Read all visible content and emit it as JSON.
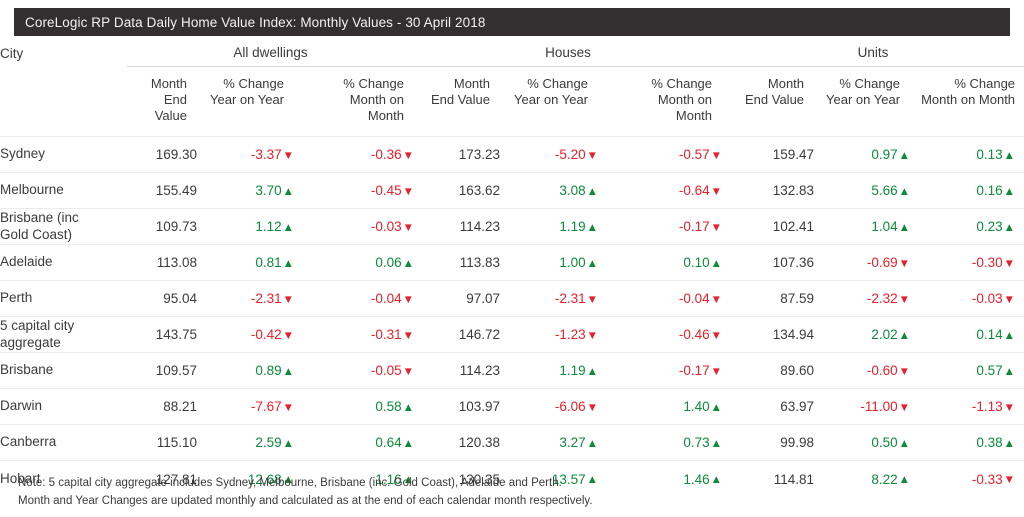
{
  "header": {
    "title": "CoreLogic RP Data Daily Home Value Index: Monthly Values - 30 April 2018"
  },
  "table": {
    "city_column_label": "City",
    "groups": [
      {
        "label": "All dwellings"
      },
      {
        "label": "Houses"
      },
      {
        "label": "Units"
      }
    ],
    "sub_headers": [
      "Month\nEnd Value",
      "% Change\nYear on Year",
      "% Change\nMonth on\nMonth",
      "Month\nEnd Value",
      "% Change\nYear on Year",
      "% Change\nMonth on\nMonth",
      "Month\nEnd Value",
      "% Change\nYear on Year",
      "% Change\nMonth on Month"
    ],
    "sub_headers_lines": {
      "month_end_value": [
        "Month",
        "End Value"
      ],
      "pct_year_on_year": [
        "% Change",
        "Year on Year"
      ],
      "pct_month_on_month": [
        "% Change",
        "Month on",
        "Month"
      ],
      "pct_month_on_month_wide": [
        "% Change",
        "Month on Month"
      ]
    },
    "colors": {
      "up": "#0d8a3a",
      "down": "#e8202c",
      "title_bar": "#332f30",
      "text": "#3b3b3b",
      "rule": "#ebebeb"
    },
    "arrows": {
      "up": "▲",
      "down": "▼"
    },
    "rows": [
      {
        "city": "Sydney",
        "all_value": "169.30",
        "all_yoy": "-3.37",
        "all_yoy_dir": "down",
        "all_mom": "-0.36",
        "all_mom_dir": "down",
        "house_value": "173.23",
        "house_yoy": "-5.20",
        "house_yoy_dir": "down",
        "house_mom": "-0.57",
        "house_mom_dir": "down",
        "unit_value": "159.47",
        "unit_yoy": "0.97",
        "unit_yoy_dir": "up",
        "unit_mom": "0.13",
        "unit_mom_dir": "up"
      },
      {
        "city": "Melbourne",
        "all_value": "155.49",
        "all_yoy": "3.70",
        "all_yoy_dir": "up",
        "all_mom": "-0.45",
        "all_mom_dir": "down",
        "house_value": "163.62",
        "house_yoy": "3.08",
        "house_yoy_dir": "up",
        "house_mom": "-0.64",
        "house_mom_dir": "down",
        "unit_value": "132.83",
        "unit_yoy": "5.66",
        "unit_yoy_dir": "up",
        "unit_mom": "0.16",
        "unit_mom_dir": "up"
      },
      {
        "city": "Brisbane (inc\nGold Coast)",
        "city_line1": "Brisbane (inc",
        "city_line2": "Gold Coast)",
        "all_value": "109.73",
        "all_yoy": "1.12",
        "all_yoy_dir": "up",
        "all_mom": "-0.03",
        "all_mom_dir": "down",
        "house_value": "114.23",
        "house_yoy": "1.19",
        "house_yoy_dir": "up",
        "house_mom": "-0.17",
        "house_mom_dir": "down",
        "unit_value": "102.41",
        "unit_yoy": "1.04",
        "unit_yoy_dir": "up",
        "unit_mom": "0.23",
        "unit_mom_dir": "up"
      },
      {
        "city": "Adelaide",
        "all_value": "113.08",
        "all_yoy": "0.81",
        "all_yoy_dir": "up",
        "all_mom": "0.06",
        "all_mom_dir": "up",
        "house_value": "113.83",
        "house_yoy": "1.00",
        "house_yoy_dir": "up",
        "house_mom": "0.10",
        "house_mom_dir": "up",
        "unit_value": "107.36",
        "unit_yoy": "-0.69",
        "unit_yoy_dir": "down",
        "unit_mom": "-0.30",
        "unit_mom_dir": "down"
      },
      {
        "city": "Perth",
        "all_value": "95.04",
        "all_yoy": "-2.31",
        "all_yoy_dir": "down",
        "all_mom": "-0.04",
        "all_mom_dir": "down",
        "house_value": "97.07",
        "house_yoy": "-2.31",
        "house_yoy_dir": "down",
        "house_mom": "-0.04",
        "house_mom_dir": "down",
        "unit_value": "87.59",
        "unit_yoy": "-2.32",
        "unit_yoy_dir": "down",
        "unit_mom": "-0.03",
        "unit_mom_dir": "down"
      },
      {
        "city": "5 capital city\naggregate",
        "city_line1": "5 capital city",
        "city_line2": "aggregate",
        "all_value": "143.75",
        "all_yoy": "-0.42",
        "all_yoy_dir": "down",
        "all_mom": "-0.31",
        "all_mom_dir": "down",
        "house_value": "146.72",
        "house_yoy": "-1.23",
        "house_yoy_dir": "down",
        "house_mom": "-0.46",
        "house_mom_dir": "down",
        "unit_value": "134.94",
        "unit_yoy": "2.02",
        "unit_yoy_dir": "up",
        "unit_mom": "0.14",
        "unit_mom_dir": "up"
      },
      {
        "city": "Brisbane",
        "all_value": "109.57",
        "all_yoy": "0.89",
        "all_yoy_dir": "up",
        "all_mom": "-0.05",
        "all_mom_dir": "down",
        "house_value": "114.23",
        "house_yoy": "1.19",
        "house_yoy_dir": "up",
        "house_mom": "-0.17",
        "house_mom_dir": "down",
        "unit_value": "89.60",
        "unit_yoy": "-0.60",
        "unit_yoy_dir": "down",
        "unit_mom": "0.57",
        "unit_mom_dir": "up"
      },
      {
        "city": "Darwin",
        "all_value": "88.21",
        "all_yoy": "-7.67",
        "all_yoy_dir": "down",
        "all_mom": "0.58",
        "all_mom_dir": "up",
        "house_value": "103.97",
        "house_yoy": "-6.06",
        "house_yoy_dir": "down",
        "house_mom": "1.40",
        "house_mom_dir": "up",
        "unit_value": "63.97",
        "unit_yoy": "-11.00",
        "unit_yoy_dir": "down",
        "unit_mom": "-1.13",
        "unit_mom_dir": "down"
      },
      {
        "city": "Canberra",
        "all_value": "115.10",
        "all_yoy": "2.59",
        "all_yoy_dir": "up",
        "all_mom": "0.64",
        "all_mom_dir": "up",
        "house_value": "120.38",
        "house_yoy": "3.27",
        "house_yoy_dir": "up",
        "house_mom": "0.73",
        "house_mom_dir": "up",
        "unit_value": "99.98",
        "unit_yoy": "0.50",
        "unit_yoy_dir": "up",
        "unit_mom": "0.38",
        "unit_mom_dir": "up"
      },
      {
        "city": "Hobart",
        "all_value": "127.81",
        "all_yoy": "12.68",
        "all_yoy_dir": "up",
        "all_mom": "1.16",
        "all_mom_dir": "up",
        "house_value": "130.35",
        "house_yoy": "13.57",
        "house_yoy_dir": "up",
        "house_mom": "1.46",
        "house_mom_dir": "up",
        "unit_value": "114.81",
        "unit_yoy": "8.22",
        "unit_yoy_dir": "up",
        "unit_mom": "-0.33",
        "unit_mom_dir": "down"
      }
    ]
  },
  "footer": {
    "line1": "Note: 5 capital city aggregate includes Sydney, Melbourne, Brisbane (inc. Gold Coast), Adelaide and Perth.",
    "line2": "Month and Year Changes are updated monthly and calculated as at the end of each calendar month respectively."
  }
}
